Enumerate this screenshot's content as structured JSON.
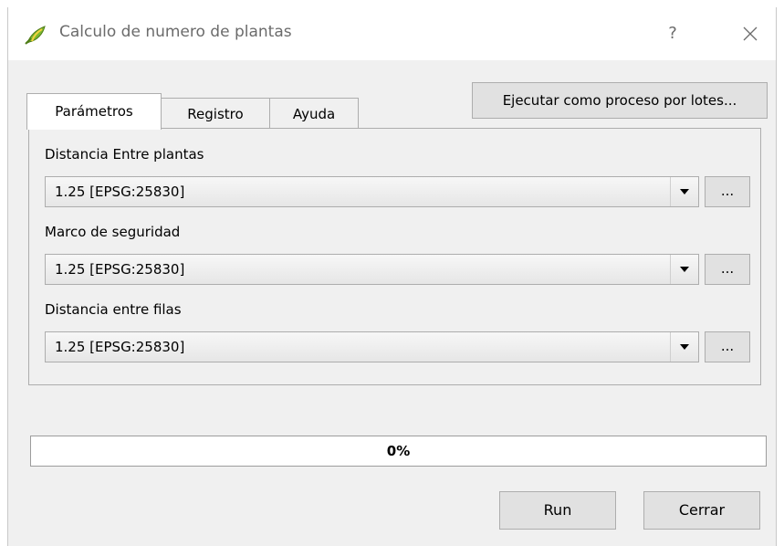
{
  "window": {
    "title": "Calculo de numero de plantas",
    "help_label": "?",
    "icon": "qgis-leaf-icon"
  },
  "tabs": [
    {
      "label": "Parámetros",
      "active": true
    },
    {
      "label": "Registro",
      "active": false
    },
    {
      "label": "Ayuda",
      "active": false
    }
  ],
  "batch_button_label": "Ejecutar como proceso por lotes...",
  "params": [
    {
      "label": "Distancia Entre plantas",
      "value": "1.25 [EPSG:25830]",
      "browse_label": "..."
    },
    {
      "label": "Marco de seguridad",
      "value": "1.25 [EPSG:25830]",
      "browse_label": "..."
    },
    {
      "label": "Distancia entre filas",
      "value": "1.25 [EPSG:25830]",
      "browse_label": "..."
    }
  ],
  "progress": {
    "percent": 0,
    "label": "0%"
  },
  "buttons": {
    "run_label": "Run",
    "close_label": "Cerrar"
  },
  "colors": {
    "progress_fill": "#06b025",
    "icon_green": "#7cb82f"
  }
}
